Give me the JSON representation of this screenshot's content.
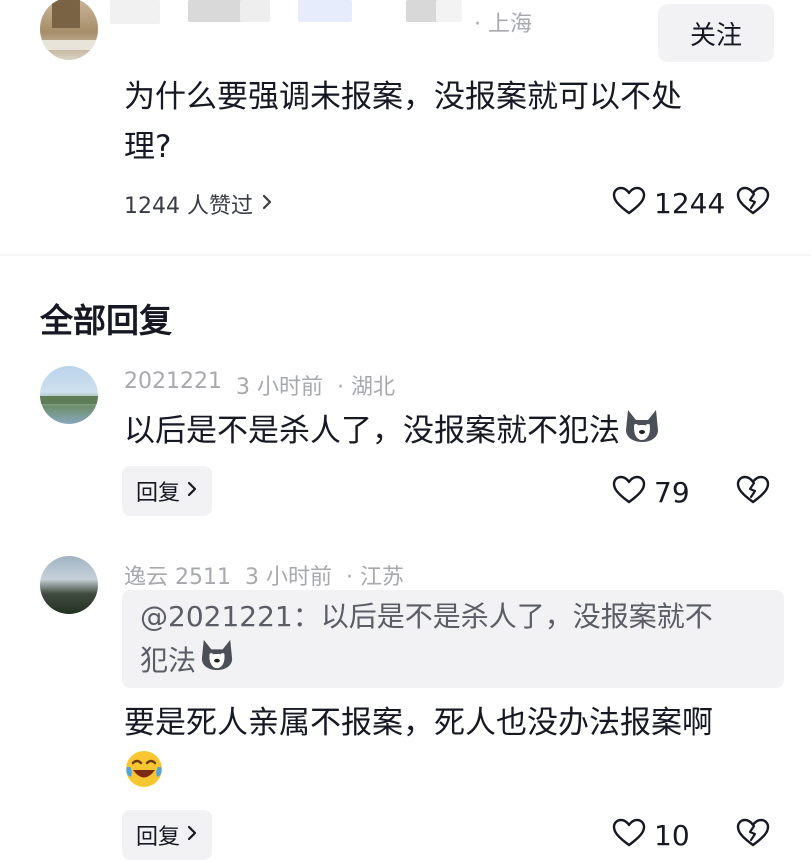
{
  "top_comment": {
    "location": "· 上海",
    "follow_label": "关注",
    "text_line1": "为什么要强调未报案，没报案就可以不处",
    "text_line2": "理?",
    "likers_text": "1244 人赞过",
    "like_count": "1244"
  },
  "replies_header": "全部回复",
  "replies": [
    {
      "username": "2021221",
      "time": "3 小时前",
      "location": "· 湖北",
      "text": "以后是不是杀人了，没报案就不犯法",
      "reply_label": "回复",
      "like_count": "79"
    },
    {
      "username": "逸云 2511",
      "time": "3 小时前",
      "location": "· 江苏",
      "quote_line1": "@2021221：以后是不是杀人了，没报案就不",
      "quote_line2": "犯法",
      "text": "要是死人亲属不报案，死人也没办法报案啊",
      "reply_label": "回复",
      "like_count": "10"
    }
  ],
  "icons": [
    "heart-icon",
    "broken-heart-icon",
    "chevron-right-icon",
    "husky-emoji",
    "laughing-emoji"
  ]
}
